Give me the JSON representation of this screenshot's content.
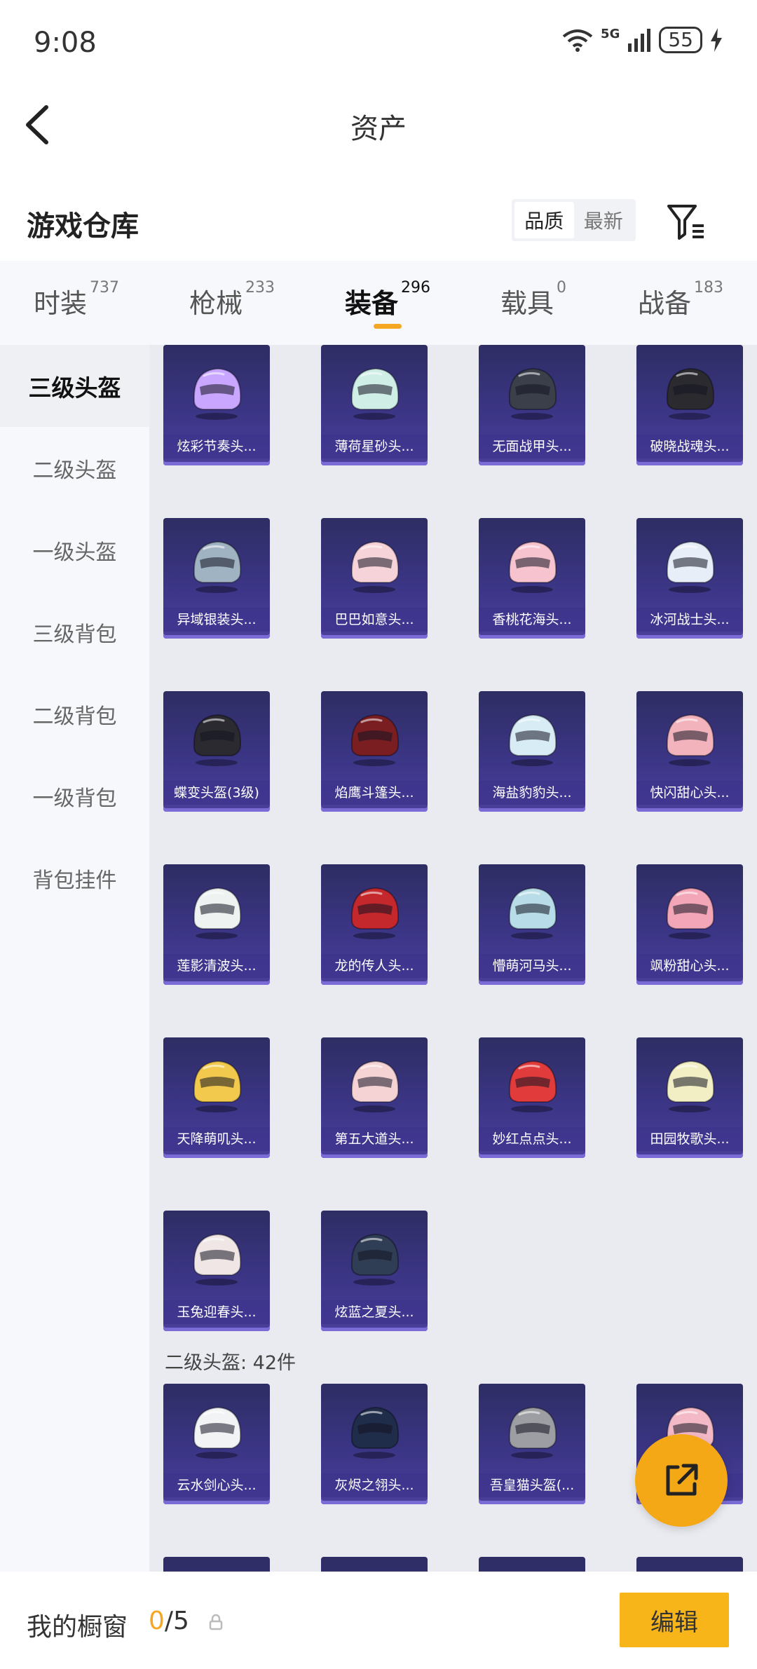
{
  "status_bar": {
    "time": "9:08",
    "network": "5G",
    "battery": "55"
  },
  "header": {
    "title": "资产"
  },
  "toolbar": {
    "title": "游戏仓库",
    "sort": [
      {
        "label": "品质",
        "active": true
      },
      {
        "label": "最新",
        "active": false
      }
    ]
  },
  "tabs": [
    {
      "label": "时装",
      "count": "737",
      "active": false
    },
    {
      "label": "枪械",
      "count": "233",
      "active": false
    },
    {
      "label": "装备",
      "count": "296",
      "active": true
    },
    {
      "label": "载具",
      "count": "0",
      "active": false
    },
    {
      "label": "战备",
      "count": "183",
      "active": false
    }
  ],
  "sidebar": [
    {
      "label": "三级头盔",
      "active": true
    },
    {
      "label": "二级头盔",
      "active": false
    },
    {
      "label": "一级头盔",
      "active": false
    },
    {
      "label": "三级背包",
      "active": false
    },
    {
      "label": "二级背包",
      "active": false
    },
    {
      "label": "一级背包",
      "active": false
    },
    {
      "label": "背包挂件",
      "active": false
    }
  ],
  "items": [
    {
      "name": "炫彩节奏头...",
      "color": "#c9a6ff"
    },
    {
      "name": "薄荷星砂头...",
      "color": "#cfeee6"
    },
    {
      "name": "无面战甲头...",
      "color": "#3a3f4a"
    },
    {
      "name": "破晓战魂头...",
      "color": "#2b2b2f"
    },
    {
      "name": "异域银装头...",
      "color": "#9fb3c2"
    },
    {
      "name": "巴巴如意头...",
      "color": "#f6d3d8"
    },
    {
      "name": "香桃花海头...",
      "color": "#f7c3cf"
    },
    {
      "name": "冰河战士头...",
      "color": "#e7eef8"
    },
    {
      "name": "蝶变头盔(3级)",
      "color": "#2a2a30"
    },
    {
      "name": "焰鹰斗篷头...",
      "color": "#7a1e22"
    },
    {
      "name": "海盐豹豹头...",
      "color": "#d7ecf4"
    },
    {
      "name": "快闪甜心头...",
      "color": "#f2b3bd"
    },
    {
      "name": "莲影清波头...",
      "color": "#eef2f0"
    },
    {
      "name": "龙的传人头...",
      "color": "#c4272c"
    },
    {
      "name": "懵萌河马头...",
      "color": "#b9dde8"
    },
    {
      "name": "飒粉甜心头...",
      "color": "#f3a6b8"
    },
    {
      "name": "天降萌叽头...",
      "color": "#f2c94c"
    },
    {
      "name": "第五大道头...",
      "color": "#f5d2d4"
    },
    {
      "name": "妙红点点头...",
      "color": "#e23b3b"
    },
    {
      "name": "田园牧歌头...",
      "color": "#f2efc4"
    },
    {
      "name": "玉兔迎春头...",
      "color": "#f0e6e6"
    },
    {
      "name": "炫蓝之夏头...",
      "color": "#2f3e55"
    }
  ],
  "section2": {
    "label": "二级头盔: 42件"
  },
  "items2": [
    {
      "name": "云水剑心头...",
      "color": "#f1f3f5"
    },
    {
      "name": "灰烬之翎头...",
      "color": "#1f2c4a"
    },
    {
      "name": "吾皇猫头盔(...",
      "color": "#9c9ea3"
    },
    {
      "name": "",
      "color": "#f3b9c6"
    }
  ],
  "bottom": {
    "title": "我的橱窗",
    "count_current": "0",
    "count_total": "/5",
    "edit_label": "编辑"
  },
  "accent_color": "#f5a623"
}
